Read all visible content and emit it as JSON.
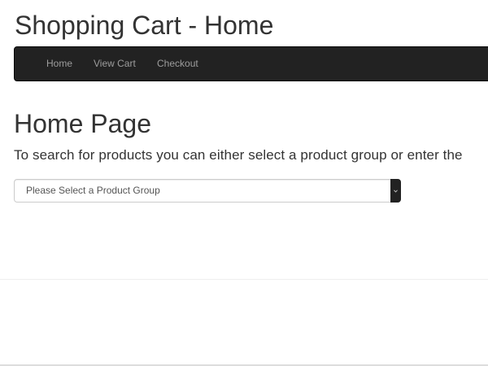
{
  "header": {
    "title": "Shopping Cart - Home"
  },
  "nav": {
    "items": [
      {
        "label": "Home"
      },
      {
        "label": "View Cart"
      },
      {
        "label": "Checkout"
      }
    ]
  },
  "main": {
    "heading": "Home Page",
    "intro": "To search for products you can either select a product group or enter the",
    "product_group_select": {
      "selected": "Please Select a Product Group",
      "icon": "chevron-down-icon"
    }
  },
  "colors": {
    "navbar_bg": "#222222",
    "nav_text": "#9d9d9d",
    "text": "#333333"
  }
}
